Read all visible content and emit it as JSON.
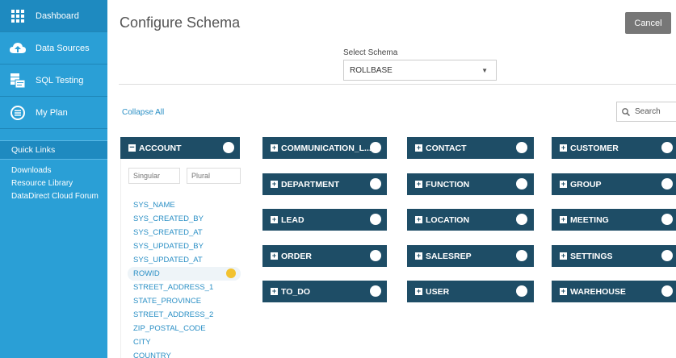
{
  "sidebar": {
    "items": [
      {
        "label": "Dashboard",
        "icon": "grid-icon",
        "active": true
      },
      {
        "label": "Data Sources",
        "icon": "cloud-upload-icon"
      },
      {
        "label": "SQL Testing",
        "icon": "sql-testing-icon"
      },
      {
        "label": "My Plan",
        "icon": "list-circle-icon"
      }
    ],
    "quick_links_title": "Quick Links",
    "quick_links": [
      "Downloads",
      "Resource Library",
      "DataDirect Cloud Forum"
    ]
  },
  "header": {
    "title": "Configure Schema",
    "cancel_label": "Cancel"
  },
  "schema": {
    "label": "Select Schema",
    "value": "ROLLBASE",
    "caret": "▼"
  },
  "toolbar": {
    "collapse_all": "Collapse All",
    "search_placeholder": "Search"
  },
  "account": {
    "name": "ACCOUNT",
    "singular_placeholder": "Singular",
    "plural_placeholder": "Plural",
    "columns": [
      "SYS_NAME",
      "SYS_CREATED_BY",
      "SYS_CREATED_AT",
      "SYS_UPDATED_BY",
      "SYS_UPDATED_AT",
      "ROWID",
      "STREET_ADDRESS_1",
      "STATE_PROVINCE",
      "STREET_ADDRESS_2",
      "ZIP_POSTAL_CODE",
      "CITY",
      "COUNTRY"
    ]
  },
  "tables": [
    [
      "COMMUNICATION_L...",
      "CONTACT",
      "CUSTOMER"
    ],
    [
      "DEPARTMENT",
      "FUNCTION",
      "GROUP"
    ],
    [
      "LEAD",
      "LOCATION",
      "MEETING"
    ],
    [
      "ORDER",
      "SALESREP",
      "SETTINGS"
    ],
    [
      "TO_DO",
      "USER",
      "WAREHOUSE"
    ]
  ],
  "colors": {
    "sidebar": "#2a9fd6",
    "card": "#1e4d66",
    "link": "#2a8fc5",
    "key": "#f2c230"
  }
}
